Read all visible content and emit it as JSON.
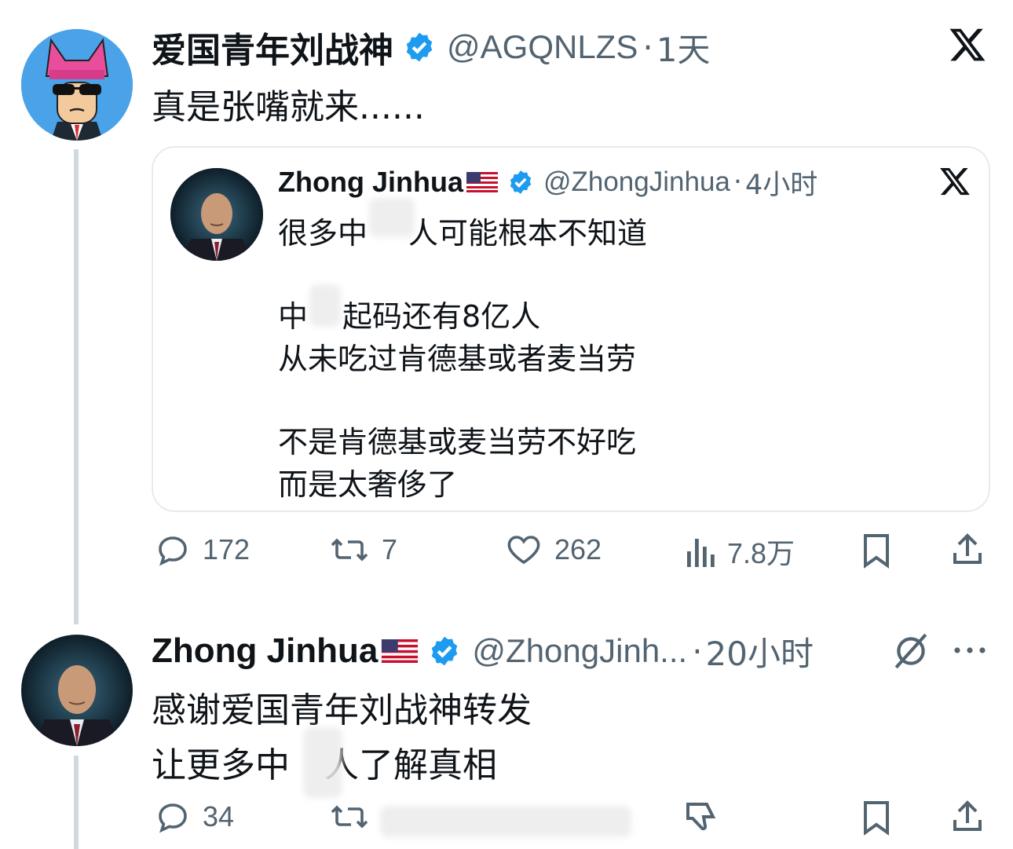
{
  "colors": {
    "verified": "#1d9bf0",
    "muted": "#536471",
    "text": "#0f1419",
    "line": "#cfd9de"
  },
  "post1": {
    "name": "爱国青年刘战神",
    "handle": "@AGQNLZS",
    "sep": "·",
    "time": "1天",
    "text": "真是张嘴就来......",
    "actions": {
      "reply_count": "172",
      "retweet_count": "7",
      "like_count": "262",
      "view_count": "7.8万"
    }
  },
  "quote": {
    "name": "Zhong Jinhua",
    "flag": "🇺🇸",
    "handle": "@ZhongJinhua",
    "sep": "·",
    "time": "4小时",
    "lines": [
      "很多中",
      "人可能根本不知道",
      "中",
      "起码还有8亿人",
      "从未吃过肯德基或者麦当劳",
      "不是肯德基或麦当劳不好吃",
      "而是太奢侈了"
    ]
  },
  "post2": {
    "name": "Zhong Jinhua",
    "flag": "🇺🇸",
    "handle": "@ZhongJinh...",
    "sep": "·",
    "time": "20小时",
    "lines": [
      "感谢爱国青年刘战神转发",
      "让更多中",
      "人了解真相"
    ],
    "actions": {
      "reply_count": "34"
    }
  },
  "icons": [
    "verified-badge-icon",
    "x-logo-icon",
    "reply-icon",
    "retweet-icon",
    "like-icon",
    "views-icon",
    "bookmark-icon",
    "share-icon",
    "grok-icon",
    "more-icon",
    "dislike-icon"
  ]
}
